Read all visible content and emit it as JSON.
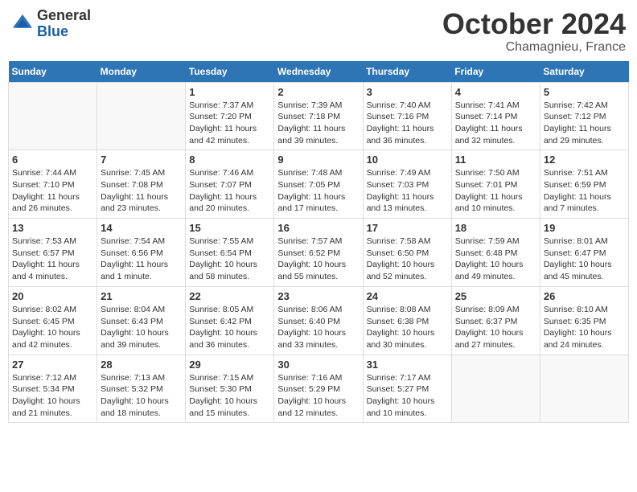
{
  "header": {
    "logo_general": "General",
    "logo_blue": "Blue",
    "month_title": "October 2024",
    "location": "Chamagnieu, France"
  },
  "weekdays": [
    "Sunday",
    "Monday",
    "Tuesday",
    "Wednesday",
    "Thursday",
    "Friday",
    "Saturday"
  ],
  "weeks": [
    [
      {
        "day": "",
        "sunrise": "",
        "sunset": "",
        "daylight": ""
      },
      {
        "day": "",
        "sunrise": "",
        "sunset": "",
        "daylight": ""
      },
      {
        "day": "1",
        "sunrise": "Sunrise: 7:37 AM",
        "sunset": "Sunset: 7:20 PM",
        "daylight": "Daylight: 11 hours and 42 minutes."
      },
      {
        "day": "2",
        "sunrise": "Sunrise: 7:39 AM",
        "sunset": "Sunset: 7:18 PM",
        "daylight": "Daylight: 11 hours and 39 minutes."
      },
      {
        "day": "3",
        "sunrise": "Sunrise: 7:40 AM",
        "sunset": "Sunset: 7:16 PM",
        "daylight": "Daylight: 11 hours and 36 minutes."
      },
      {
        "day": "4",
        "sunrise": "Sunrise: 7:41 AM",
        "sunset": "Sunset: 7:14 PM",
        "daylight": "Daylight: 11 hours and 32 minutes."
      },
      {
        "day": "5",
        "sunrise": "Sunrise: 7:42 AM",
        "sunset": "Sunset: 7:12 PM",
        "daylight": "Daylight: 11 hours and 29 minutes."
      }
    ],
    [
      {
        "day": "6",
        "sunrise": "Sunrise: 7:44 AM",
        "sunset": "Sunset: 7:10 PM",
        "daylight": "Daylight: 11 hours and 26 minutes."
      },
      {
        "day": "7",
        "sunrise": "Sunrise: 7:45 AM",
        "sunset": "Sunset: 7:08 PM",
        "daylight": "Daylight: 11 hours and 23 minutes."
      },
      {
        "day": "8",
        "sunrise": "Sunrise: 7:46 AM",
        "sunset": "Sunset: 7:07 PM",
        "daylight": "Daylight: 11 hours and 20 minutes."
      },
      {
        "day": "9",
        "sunrise": "Sunrise: 7:48 AM",
        "sunset": "Sunset: 7:05 PM",
        "daylight": "Daylight: 11 hours and 17 minutes."
      },
      {
        "day": "10",
        "sunrise": "Sunrise: 7:49 AM",
        "sunset": "Sunset: 7:03 PM",
        "daylight": "Daylight: 11 hours and 13 minutes."
      },
      {
        "day": "11",
        "sunrise": "Sunrise: 7:50 AM",
        "sunset": "Sunset: 7:01 PM",
        "daylight": "Daylight: 11 hours and 10 minutes."
      },
      {
        "day": "12",
        "sunrise": "Sunrise: 7:51 AM",
        "sunset": "Sunset: 6:59 PM",
        "daylight": "Daylight: 11 hours and 7 minutes."
      }
    ],
    [
      {
        "day": "13",
        "sunrise": "Sunrise: 7:53 AM",
        "sunset": "Sunset: 6:57 PM",
        "daylight": "Daylight: 11 hours and 4 minutes."
      },
      {
        "day": "14",
        "sunrise": "Sunrise: 7:54 AM",
        "sunset": "Sunset: 6:56 PM",
        "daylight": "Daylight: 11 hours and 1 minute."
      },
      {
        "day": "15",
        "sunrise": "Sunrise: 7:55 AM",
        "sunset": "Sunset: 6:54 PM",
        "daylight": "Daylight: 10 hours and 58 minutes."
      },
      {
        "day": "16",
        "sunrise": "Sunrise: 7:57 AM",
        "sunset": "Sunset: 6:52 PM",
        "daylight": "Daylight: 10 hours and 55 minutes."
      },
      {
        "day": "17",
        "sunrise": "Sunrise: 7:58 AM",
        "sunset": "Sunset: 6:50 PM",
        "daylight": "Daylight: 10 hours and 52 minutes."
      },
      {
        "day": "18",
        "sunrise": "Sunrise: 7:59 AM",
        "sunset": "Sunset: 6:48 PM",
        "daylight": "Daylight: 10 hours and 49 minutes."
      },
      {
        "day": "19",
        "sunrise": "Sunrise: 8:01 AM",
        "sunset": "Sunset: 6:47 PM",
        "daylight": "Daylight: 10 hours and 45 minutes."
      }
    ],
    [
      {
        "day": "20",
        "sunrise": "Sunrise: 8:02 AM",
        "sunset": "Sunset: 6:45 PM",
        "daylight": "Daylight: 10 hours and 42 minutes."
      },
      {
        "day": "21",
        "sunrise": "Sunrise: 8:04 AM",
        "sunset": "Sunset: 6:43 PM",
        "daylight": "Daylight: 10 hours and 39 minutes."
      },
      {
        "day": "22",
        "sunrise": "Sunrise: 8:05 AM",
        "sunset": "Sunset: 6:42 PM",
        "daylight": "Daylight: 10 hours and 36 minutes."
      },
      {
        "day": "23",
        "sunrise": "Sunrise: 8:06 AM",
        "sunset": "Sunset: 6:40 PM",
        "daylight": "Daylight: 10 hours and 33 minutes."
      },
      {
        "day": "24",
        "sunrise": "Sunrise: 8:08 AM",
        "sunset": "Sunset: 6:38 PM",
        "daylight": "Daylight: 10 hours and 30 minutes."
      },
      {
        "day": "25",
        "sunrise": "Sunrise: 8:09 AM",
        "sunset": "Sunset: 6:37 PM",
        "daylight": "Daylight: 10 hours and 27 minutes."
      },
      {
        "day": "26",
        "sunrise": "Sunrise: 8:10 AM",
        "sunset": "Sunset: 6:35 PM",
        "daylight": "Daylight: 10 hours and 24 minutes."
      }
    ],
    [
      {
        "day": "27",
        "sunrise": "Sunrise: 7:12 AM",
        "sunset": "Sunset: 5:34 PM",
        "daylight": "Daylight: 10 hours and 21 minutes."
      },
      {
        "day": "28",
        "sunrise": "Sunrise: 7:13 AM",
        "sunset": "Sunset: 5:32 PM",
        "daylight": "Daylight: 10 hours and 18 minutes."
      },
      {
        "day": "29",
        "sunrise": "Sunrise: 7:15 AM",
        "sunset": "Sunset: 5:30 PM",
        "daylight": "Daylight: 10 hours and 15 minutes."
      },
      {
        "day": "30",
        "sunrise": "Sunrise: 7:16 AM",
        "sunset": "Sunset: 5:29 PM",
        "daylight": "Daylight: 10 hours and 12 minutes."
      },
      {
        "day": "31",
        "sunrise": "Sunrise: 7:17 AM",
        "sunset": "Sunset: 5:27 PM",
        "daylight": "Daylight: 10 hours and 10 minutes."
      },
      {
        "day": "",
        "sunrise": "",
        "sunset": "",
        "daylight": ""
      },
      {
        "day": "",
        "sunrise": "",
        "sunset": "",
        "daylight": ""
      }
    ]
  ]
}
